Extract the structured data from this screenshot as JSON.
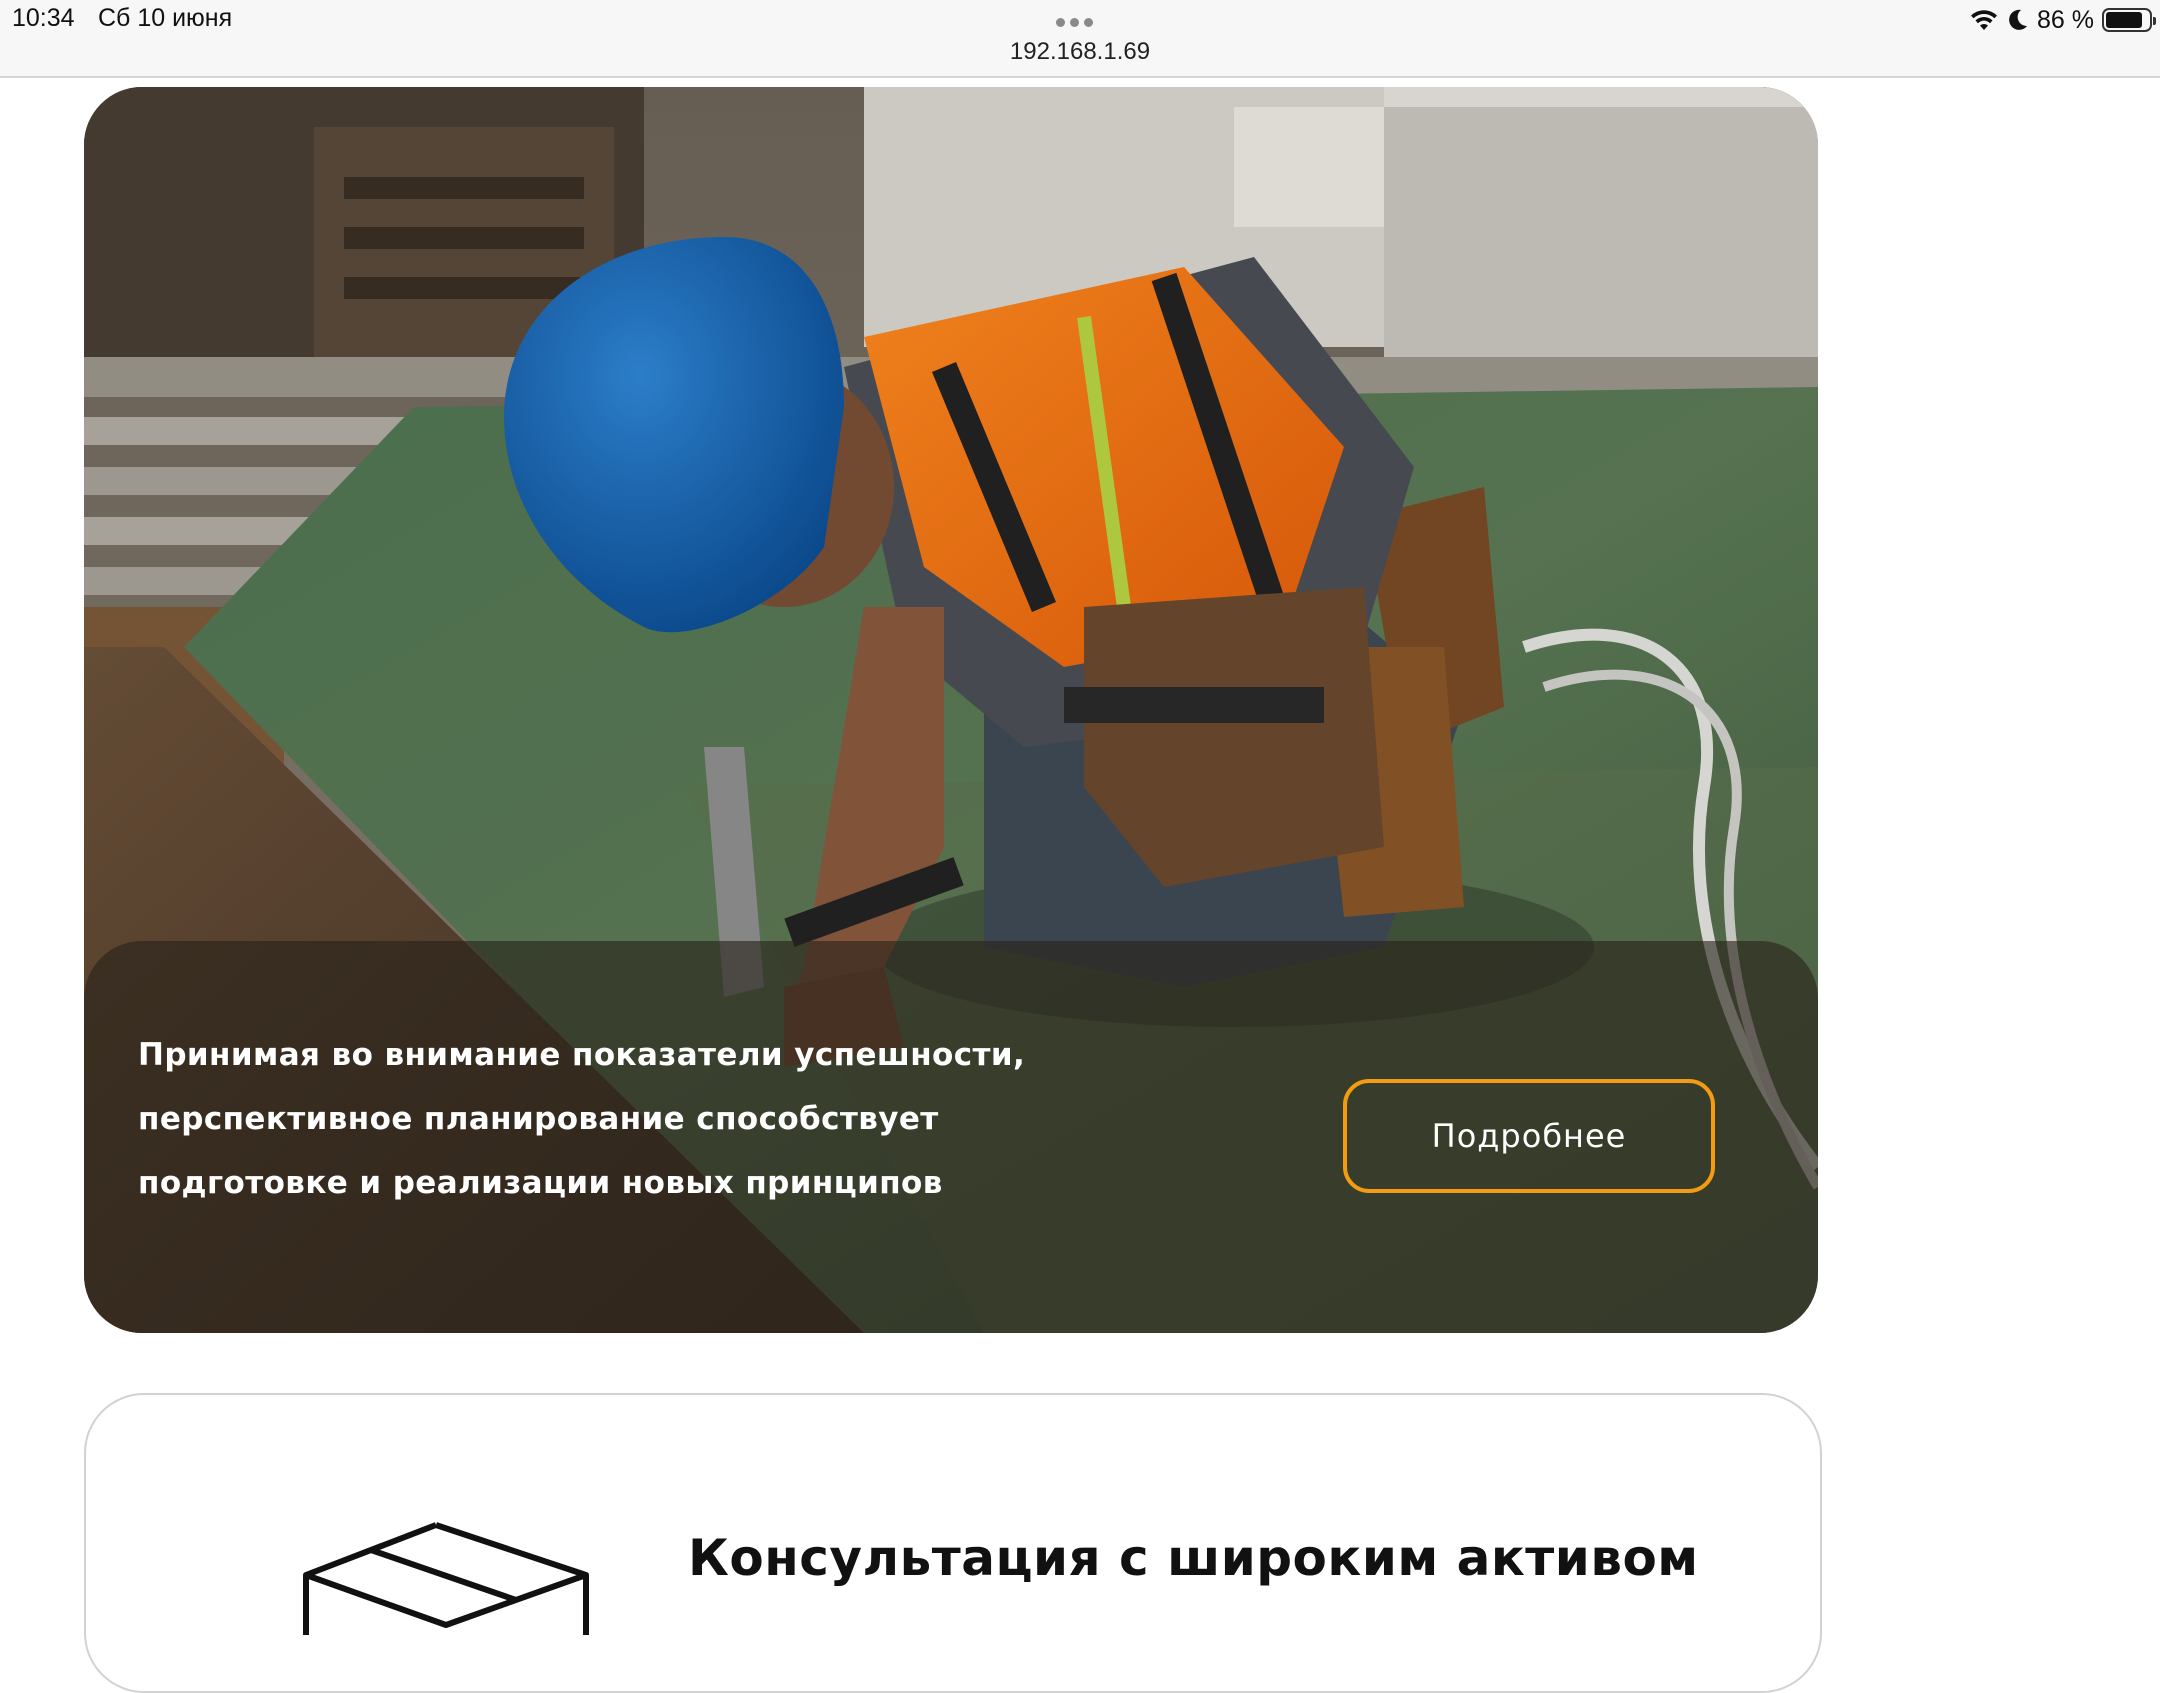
{
  "status_bar": {
    "time": "10:34",
    "date": "Сб 10 июня",
    "url": "192.168.1.69",
    "battery_text": "86 %",
    "battery_level": 0.86,
    "icons": [
      "wifi-icon",
      "moon-icon",
      "battery-icon"
    ]
  },
  "hero": {
    "text": "Принимая во внимание показатели успешности, перспективное планирование способствует подготовке и реализации новых принципов",
    "button_label": "Подробнее",
    "accent_color": "#f39c12"
  },
  "card2": {
    "title": "Консультация с широким активом",
    "icon": "box-icon"
  }
}
